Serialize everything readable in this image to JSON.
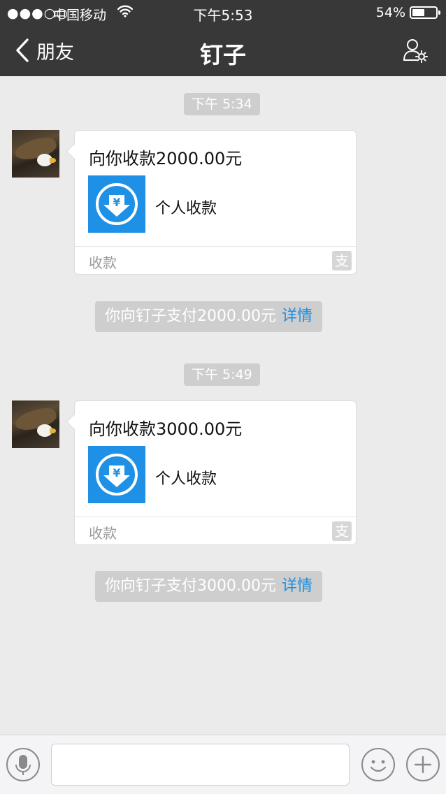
{
  "status_bar": {
    "signal": "●●●○○",
    "carrier": "中国移动",
    "time": "下午5:53",
    "battery": "54%",
    "battery_level": 0.54
  },
  "nav": {
    "back_label": "朋友",
    "title": "钉子"
  },
  "messages": [
    {
      "time": "下午 5:34",
      "card": {
        "title": "向你收款2000.00元",
        "desc": "个人收款",
        "footer": "收款",
        "badge": "支"
      },
      "notice": {
        "text": "你向钉子支付2000.00元",
        "link": "详情"
      }
    },
    {
      "time": "下午 5:49",
      "card": {
        "title": "向你收款3000.00元",
        "desc": "个人收款",
        "footer": "收款",
        "badge": "支"
      },
      "notice": {
        "text": "你向钉子支付3000.00元",
        "link": "详情"
      }
    }
  ],
  "input": {
    "placeholder": "",
    "value": ""
  },
  "colors": {
    "header_bg": "#383838",
    "chat_bg": "#ebebeb",
    "accent": "#1e91e6",
    "link": "#1d8fe0"
  },
  "icons": [
    "back-chevron-icon",
    "wifi-icon",
    "battery-icon",
    "profile-settings-icon",
    "yuan-download-icon",
    "alipay-icon",
    "microphone-icon",
    "emoji-icon",
    "plus-icon"
  ]
}
